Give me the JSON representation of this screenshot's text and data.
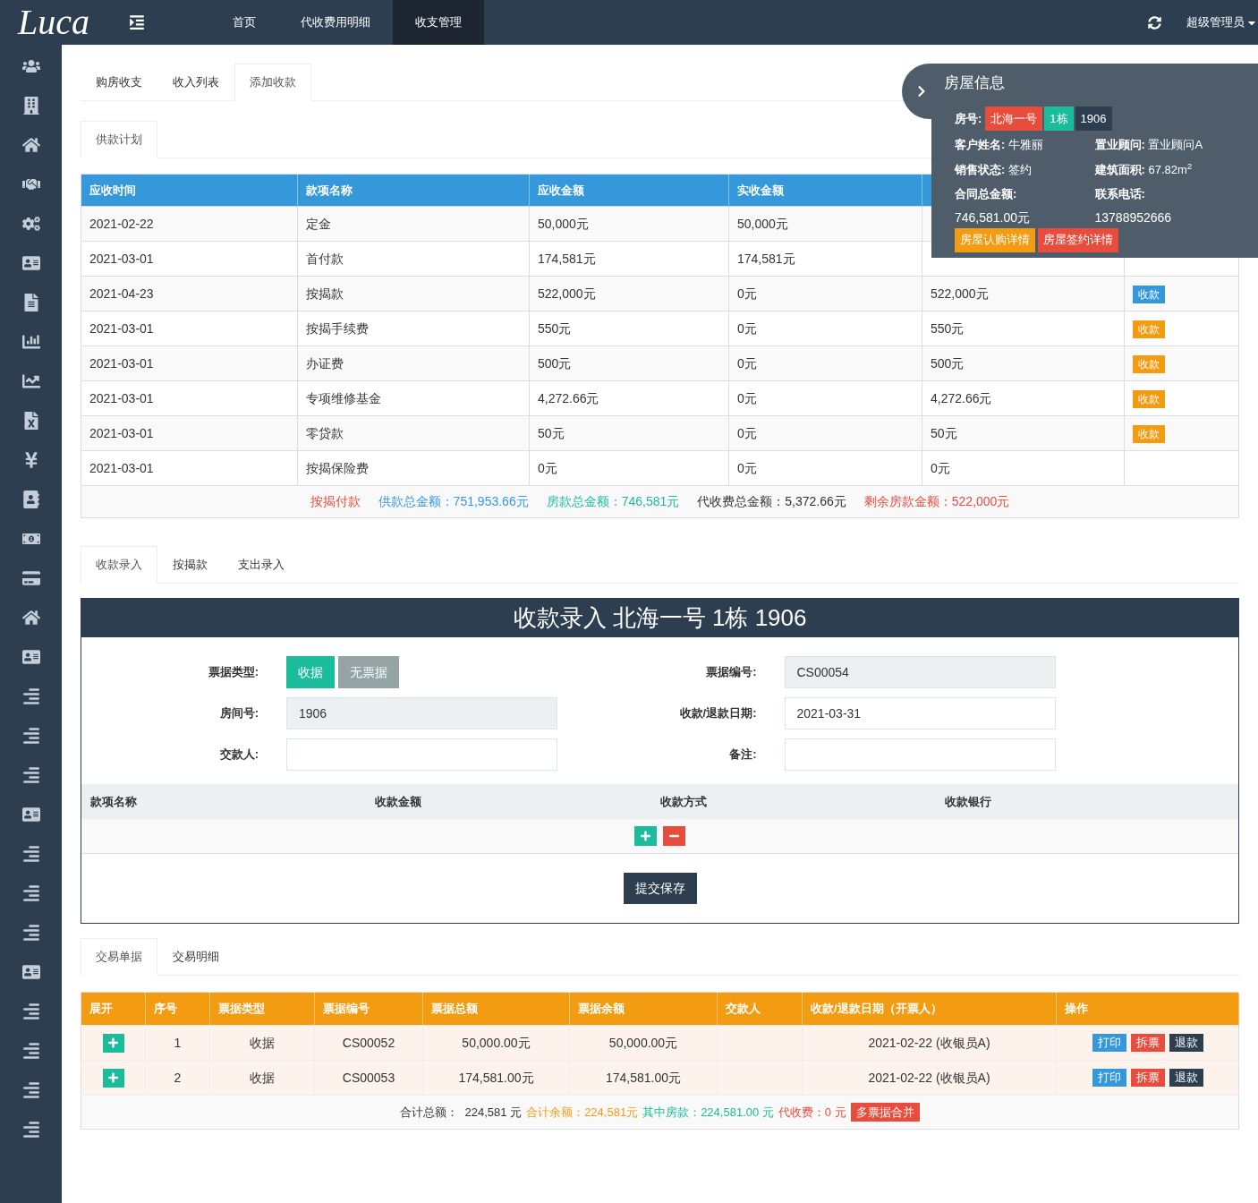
{
  "logo": "Luca",
  "top_nav": [
    {
      "label": "首页",
      "selected": false
    },
    {
      "label": "代收费用明细",
      "selected": false
    },
    {
      "label": "收支管理",
      "selected": true
    }
  ],
  "user_menu": "超级管理员",
  "main_tabs": [
    {
      "label": "购房收支",
      "selected": false
    },
    {
      "label": "收入列表",
      "selected": false
    },
    {
      "label": "添加收款",
      "selected": true
    }
  ],
  "plan_tabs": [
    {
      "label": "供款计划",
      "selected": true
    }
  ],
  "plan_table": {
    "columns": [
      "应收时间",
      "款项名称",
      "应收金额",
      "实收金额"
    ],
    "rows": [
      {
        "date": "2021-02-22",
        "item": "定金",
        "due": "50,000元",
        "received": "50,000元"
      },
      {
        "date": "2021-03-01",
        "item": "首付款",
        "due": "174,581元",
        "received": "174,581元"
      },
      {
        "date": "2021-04-23",
        "item": "按揭款",
        "due": "522,000元",
        "received": "0元",
        "pending": "522,000元",
        "action": {
          "label": "收款",
          "color": "#3498db"
        }
      },
      {
        "date": "2021-03-01",
        "item": "按揭手续费",
        "due": "550元",
        "received": "0元",
        "pending": "550元",
        "action": {
          "label": "收款",
          "color": "#f39c12"
        }
      },
      {
        "date": "2021-03-01",
        "item": "办证费",
        "due": "500元",
        "received": "0元",
        "pending": "500元",
        "action": {
          "label": "收款",
          "color": "#f39c12"
        }
      },
      {
        "date": "2021-03-01",
        "item": "专项维修基金",
        "due": "4,272.66元",
        "received": "0元",
        "pending": "4,272.66元",
        "action": {
          "label": "收款",
          "color": "#f39c12"
        }
      },
      {
        "date": "2021-03-01",
        "item": "零贷款",
        "due": "50元",
        "received": "0元",
        "pending": "50元",
        "action": {
          "label": "收款",
          "color": "#f39c12"
        }
      },
      {
        "date": "2021-03-01",
        "item": "按揭保险费",
        "due": "0元",
        "received": "0元",
        "pending": "0元"
      }
    ],
    "summary": [
      {
        "text": "按揭付款",
        "color": "#e74c3c"
      },
      {
        "text": "供款总金额：751,953.66元",
        "color": "#3498db"
      },
      {
        "text": "房款总金额：746,581元",
        "color": "#1abc9c"
      },
      {
        "text": "代收费总金额：5,372.66元",
        "color": "#333333"
      },
      {
        "text": "剩余房款金额：522,000元",
        "color": "#e74c3c"
      }
    ]
  },
  "house_info": {
    "title": "房屋信息",
    "room_label": "房号:",
    "room_badges": [
      {
        "text": "北海一号",
        "color": "#e74c3c"
      },
      {
        "text": "1栋",
        "color": "#1abc9c"
      },
      {
        "text": "1906",
        "color": "#2c3e50"
      }
    ],
    "fields": [
      {
        "label": "客户姓名:",
        "value": "牛雅丽"
      },
      {
        "label": "置业顾问:",
        "value": "置业顾问A"
      },
      {
        "label": "销售状态:",
        "value": "签约"
      },
      {
        "label": "建筑面积:",
        "value": "67.82m$^{2}$"
      }
    ],
    "contract_label": "合同总金额:",
    "contract_value": "746,581.00元",
    "phone_label": "联系电话:",
    "phone_value": "13788952666",
    "buttons": [
      {
        "label": "房屋认购详情",
        "color": "#f39c12"
      },
      {
        "label": "房屋签约详情",
        "color": "#e74c3c"
      }
    ]
  },
  "entry_tabs": [
    {
      "label": "收款录入",
      "selected": true
    },
    {
      "label": "按揭款",
      "selected": false
    },
    {
      "label": "支出录入",
      "selected": false
    }
  ],
  "entry_form": {
    "title": "收款录入 北海一号 1栋 1906",
    "left": [
      {
        "kind": "choice",
        "label": "票据类型:",
        "options": [
          {
            "label": "收据",
            "selected": true
          },
          {
            "label": "无票据",
            "selected": false
          }
        ]
      },
      {
        "kind": "input",
        "label": "房间号:",
        "value": "1906",
        "disabled": true
      },
      {
        "kind": "input",
        "label": "交款人:",
        "disabled": false
      }
    ],
    "right": [
      {
        "kind": "input",
        "label": "票据编号:",
        "value": "CS00054",
        "disabled": true
      },
      {
        "kind": "input",
        "label": "收款/退款日期:",
        "value": "2021-03-31",
        "disabled": false
      },
      {
        "kind": "input",
        "label": "备注:",
        "disabled": false
      }
    ],
    "item_columns": [
      "款项名称",
      "收款金额",
      "收款方式",
      "收款银行"
    ],
    "submit": "提交保存"
  },
  "record_tabs": [
    {
      "label": "交易单据",
      "selected": true
    },
    {
      "label": "交易明细",
      "selected": false
    }
  ],
  "records": {
    "columns": [
      "展开",
      "序号",
      "票据类型",
      "票据编号",
      "票据总额",
      "票据余额",
      "交款人",
      "收款/退款日期（开票人）",
      "操作"
    ],
    "rows": [
      {
        "no": "1",
        "type": "收据",
        "code": "CS00052",
        "total": "50,000.00元",
        "balance": "50,000.00元",
        "date": "2021-02-22 (收银员A)",
        "actions": [
          {
            "label": "打印",
            "color": "#3498db"
          },
          {
            "label": "拆票",
            "color": "#e74c3c"
          },
          {
            "label": "退款",
            "color": "#2c3e50"
          }
        ]
      },
      {
        "no": "2",
        "type": "收据",
        "code": "CS00053",
        "total": "174,581.00元",
        "balance": "174,581.00元",
        "date": "2021-02-22 (收银员A)",
        "actions": [
          {
            "label": "打印",
            "color": "#3498db"
          },
          {
            "label": "拆票",
            "color": "#e74c3c"
          },
          {
            "label": "退款",
            "color": "#2c3e50"
          }
        ]
      }
    ],
    "summary": [
      {
        "text": "合计总额：  224,581 元",
        "color": "#333333"
      },
      {
        "text": "合计余额：224,581元",
        "color": "#f39c12"
      },
      {
        "text": "其中房款：224,581.00 元",
        "color": "#1abc9c"
      },
      {
        "text": "代收费：0 元",
        "color": "#e74c3c"
      }
    ],
    "merge_button": "多票据合并"
  }
}
